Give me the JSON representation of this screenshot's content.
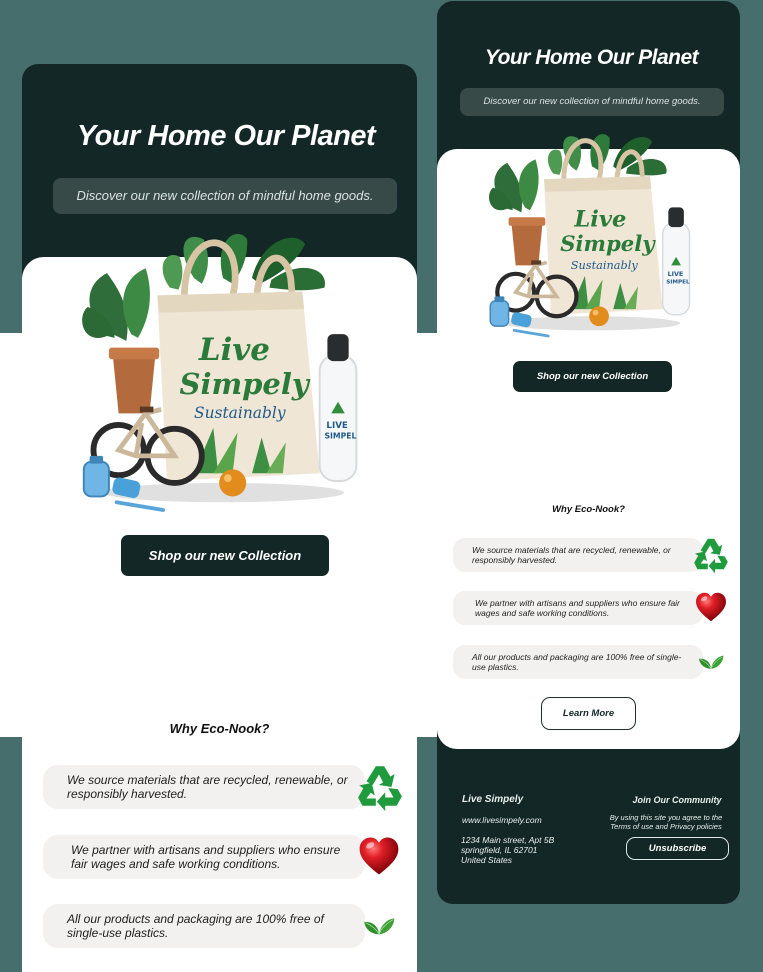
{
  "hero": {
    "title": "Your Home Our Planet",
    "subtitle": "Discover our new collection of mindful home goods."
  },
  "product_image": {
    "bag_text_line1": "Live",
    "bag_text_line2": "Simpely",
    "bag_text_line3": "Sustainably",
    "bottle_text": "LIVE SIMPEL",
    "icon": "eco-tote-bag-illustration"
  },
  "cta": {
    "shop_label": "Shop our  new  Collection"
  },
  "why": {
    "title": "Why Eco-Nook?",
    "features": [
      {
        "text": "We source materials that are recycled, renewable, or responsibly harvested.",
        "icon": "recycle-icon"
      },
      {
        "text": "We partner with artisans and suppliers who ensure fair wages and safe working conditions.",
        "icon": "heart-icon"
      },
      {
        "text": "All our products and packaging are 100% free of single-use plastics.",
        "icon": "leaf-icon"
      }
    ],
    "learn_more_label": "Learn More"
  },
  "footer": {
    "brand": "Live Simpely",
    "website": "www.livesimpely.com",
    "address_line1": "1234 Main street, Apt 5B",
    "address_line2": "springfield, IL 62701",
    "address_line3": "United States",
    "community_title": "Join Our Community",
    "policy_text": "By using this site you agree to the Terms of use and Privacy policies",
    "unsubscribe_label": "Unsubscribe"
  },
  "colors": {
    "background": "#456e6c",
    "dark": "#132826",
    "card": "#ffffff",
    "feature_bg": "#f2f1ef",
    "recycle": "#1f9a3c",
    "heart": "#c8141d",
    "leaf": "#2f8f2a"
  }
}
